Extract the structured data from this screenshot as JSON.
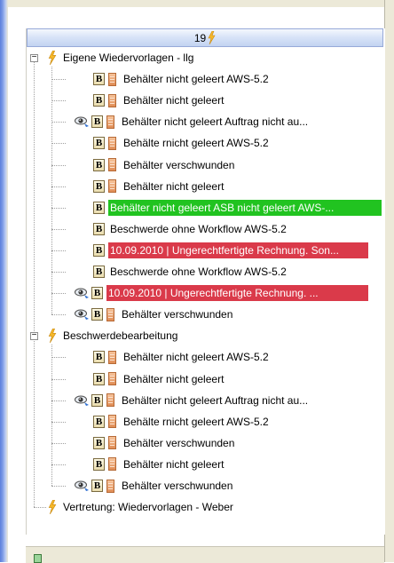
{
  "header": {
    "count": "19"
  },
  "groups": [
    {
      "title": "Eigene Wiedervorlagen - llg",
      "items": [
        {
          "label": "Behälter nicht geleert AWS-5.2",
          "eye": false,
          "doc": true,
          "hl": ""
        },
        {
          "label": "Behälter nicht geleert",
          "eye": false,
          "doc": true,
          "hl": ""
        },
        {
          "label": "Behälter nicht geleert Auftrag nicht au...",
          "eye": true,
          "doc": true,
          "hl": ""
        },
        {
          "label": "Behälte rnicht geleert AWS-5.2",
          "eye": false,
          "doc": true,
          "hl": ""
        },
        {
          "label": "Behälter verschwunden",
          "eye": false,
          "doc": true,
          "hl": ""
        },
        {
          "label": "Behälter nicht geleert",
          "eye": false,
          "doc": true,
          "hl": ""
        },
        {
          "label": "Behälter nicht geleert ASB nicht geleert AWS-...",
          "eye": false,
          "doc": false,
          "hl": "green"
        },
        {
          "label": "Beschwerde ohne Workflow AWS-5.2",
          "eye": false,
          "doc": false,
          "hl": ""
        },
        {
          "label": "10.09.2010 | Ungerechtfertigte Rechnung. Son...",
          "eye": false,
          "doc": false,
          "hl": "red"
        },
        {
          "label": "Beschwerde ohne Workflow AWS-5.2",
          "eye": false,
          "doc": false,
          "hl": ""
        },
        {
          "label": "10.09.2010 | Ungerechtfertigte Rechnung. ...",
          "eye": true,
          "doc": false,
          "hl": "red"
        },
        {
          "label": "Behälter verschwunden",
          "eye": true,
          "doc": true,
          "hl": ""
        }
      ]
    },
    {
      "title": "Beschwerdebearbeitung",
      "items": [
        {
          "label": "Behälter nicht geleert AWS-5.2",
          "eye": false,
          "doc": true,
          "hl": ""
        },
        {
          "label": "Behälter nicht geleert",
          "eye": false,
          "doc": true,
          "hl": ""
        },
        {
          "label": "Behälter nicht geleert Auftrag nicht au...",
          "eye": true,
          "doc": true,
          "hl": ""
        },
        {
          "label": "Behälte rnicht geleert AWS-5.2",
          "eye": false,
          "doc": true,
          "hl": ""
        },
        {
          "label": "Behälter verschwunden",
          "eye": false,
          "doc": true,
          "hl": ""
        },
        {
          "label": "Behälter nicht geleert",
          "eye": false,
          "doc": true,
          "hl": ""
        },
        {
          "label": "Behälter verschwunden",
          "eye": true,
          "doc": true,
          "hl": ""
        }
      ]
    },
    {
      "title": "Vertretung: Wiedervorlagen - Weber",
      "items": []
    }
  ],
  "colors": {
    "highlight_green": "#21c320",
    "highlight_red": "#da3a4a",
    "header_border": "#97aad9"
  },
  "icons": {
    "group": "lightning-bolt-icon",
    "item_type": "b-document-icon",
    "item_attachment": "orange-document-icon",
    "item_viewed": "eye-icon"
  }
}
